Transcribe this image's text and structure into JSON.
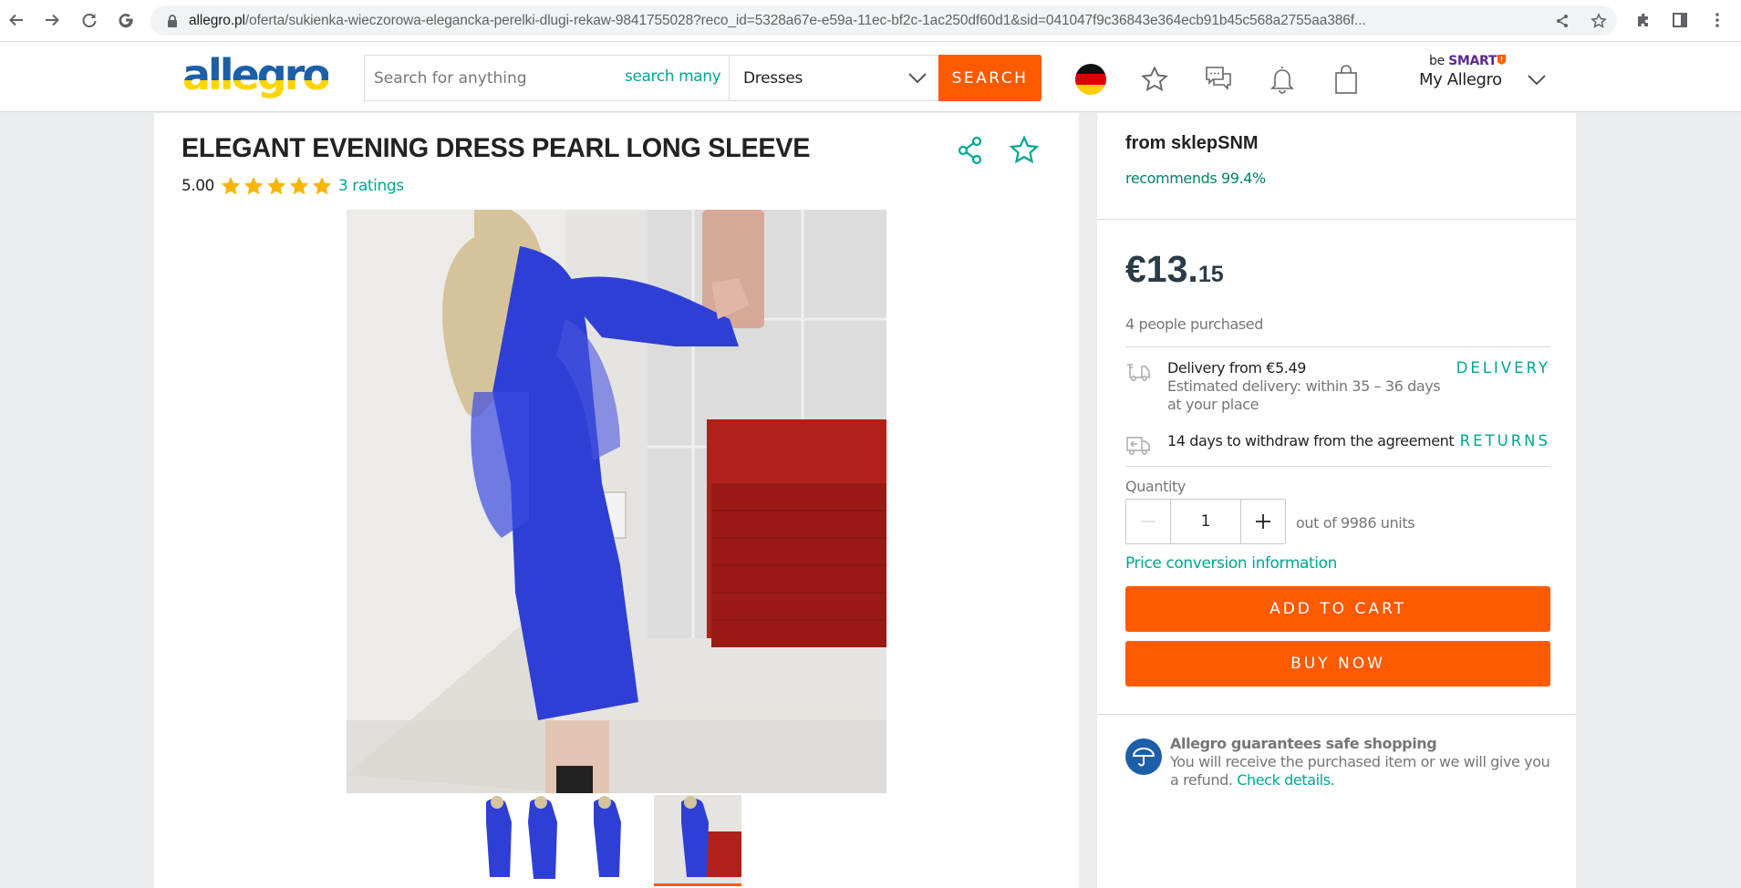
{
  "browser": {
    "url_host": "allegro.pl",
    "url_path": "/oferta/sukienka-wieczorowa-elegancka-perelki-dlugi-rekaw-9841755028?reco_id=5328a67e-e59a-11ec-bf2c-1ac250df60d1&sid=041047f9c36843e364ecb91b45c568a2755aa386f..."
  },
  "header": {
    "logo_text": "allegro",
    "search_placeholder": "Search for anything",
    "search_many": "search many",
    "category": "Dresses",
    "search_button": "SEARCH",
    "be_smart_prefix": "be",
    "be_smart_brand": "SMART",
    "my_allegro": "My Allegro"
  },
  "product": {
    "title": "ELEGANT EVENING DRESS PEARL LONG SLEEVE",
    "rating": "5.00",
    "stars": 5,
    "ratings_link": "3 ratings",
    "thumbnails": [
      {
        "label": "front-and-back-view",
        "active": false
      },
      {
        "label": "front-view",
        "active": false
      },
      {
        "label": "mirror-selfie",
        "active": true
      }
    ]
  },
  "seller": {
    "name": "from sklepSNM",
    "recommends": "recommends 99.4%"
  },
  "purchase": {
    "price_whole": "€13.",
    "price_cents": "15",
    "purchased": "4 people purchased",
    "delivery_title": "Delivery from €5.49",
    "delivery_estimate": "Estimated delivery: within 35 – 36 days",
    "delivery_place": "at your place",
    "delivery_link": "DELIVERY",
    "returns_text": "14 days to withdraw from the agreement",
    "returns_link": "RETURNS",
    "quantity_label": "Quantity",
    "quantity_value": "1",
    "quantity_available": "out of 9986 units",
    "price_conversion": "Price conversion information",
    "add_to_cart": "ADD TO CART",
    "buy_now": "BUY NOW"
  },
  "guarantee": {
    "title": "Allegro guarantees safe shopping",
    "text": "You will receive the purchased item or we will give you a refund.",
    "link": "Check details."
  },
  "colors": {
    "accent_orange": "#ff5a00",
    "link_teal": "#00a790",
    "star_gold": "#f7b500",
    "guarantee_blue": "#1c5fa8"
  }
}
